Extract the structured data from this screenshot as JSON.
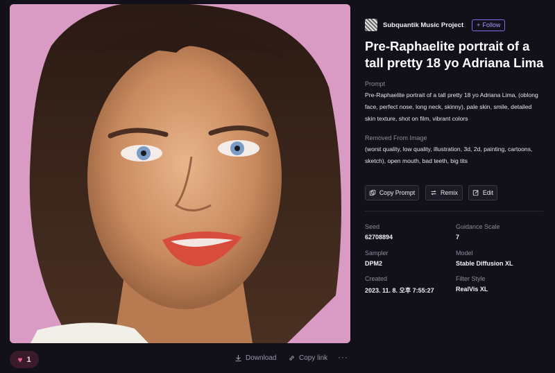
{
  "author": {
    "name": "Subquantik Music Project",
    "follow_label": "Follow"
  },
  "title": "Pre-Raphaelite portrait of a tall pretty 18 yo Adriana Lima",
  "prompt": {
    "label": "Prompt",
    "text": "Pre-Raphaelite portrait of a tall pretty 18 yo Adriana Lima, (oblong face, perfect nose, long neck, skinny), pale skin, smile, detailed skin texture, shot on film, vibrant colors"
  },
  "negative": {
    "label": "Removed From Image",
    "text": "(worst quality, low quality, illustration, 3d, 2d, painting, cartoons, sketch), open mouth, bad teeth, big tits"
  },
  "actions": {
    "copy_prompt": "Copy Prompt",
    "remix": "Remix",
    "edit": "Edit"
  },
  "meta": {
    "seed": {
      "label": "Seed",
      "value": "62708894"
    },
    "guidance": {
      "label": "Guidance Scale",
      "value": "7"
    },
    "sampler": {
      "label": "Sampler",
      "value": "DPM2"
    },
    "model": {
      "label": "Model",
      "value": "Stable Diffusion XL"
    },
    "created": {
      "label": "Created",
      "value": "2023. 11. 8. 오후 7:55:27"
    },
    "filter": {
      "label": "Filter Style",
      "value": "RealVis XL"
    }
  },
  "footer": {
    "likes": "1",
    "download": "Download",
    "copy_link": "Copy link",
    "more": "···"
  },
  "colors": {
    "background": "#121019",
    "accent": "#7a6cf0",
    "heart": "#ea5d8a"
  },
  "icons": [
    "heart-icon",
    "download-icon",
    "link-icon",
    "copy-icon",
    "remix-icon",
    "edit-icon",
    "plus-icon"
  ]
}
